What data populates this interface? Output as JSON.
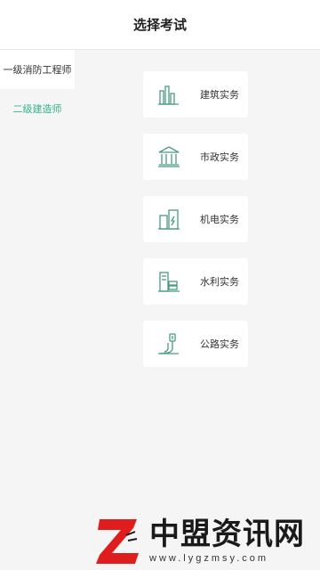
{
  "header": {
    "title": "选择考试"
  },
  "sidebar": {
    "items": [
      {
        "label": "一级消防工程师"
      },
      {
        "label": "二级建造师"
      }
    ]
  },
  "cards": [
    {
      "label": "建筑实务",
      "icon": "building-bars-icon"
    },
    {
      "label": "市政实务",
      "icon": "government-building-icon"
    },
    {
      "label": "机电实务",
      "icon": "electric-panel-icon"
    },
    {
      "label": "水利实务",
      "icon": "water-conservancy-icon"
    },
    {
      "label": "公路实务",
      "icon": "road-icon"
    }
  ],
  "watermark": {
    "title": "中盟资讯网",
    "url": "www.lygzmsy.com"
  },
  "colors": {
    "accent": "#33b28c",
    "icon": "#4a9b7f"
  }
}
